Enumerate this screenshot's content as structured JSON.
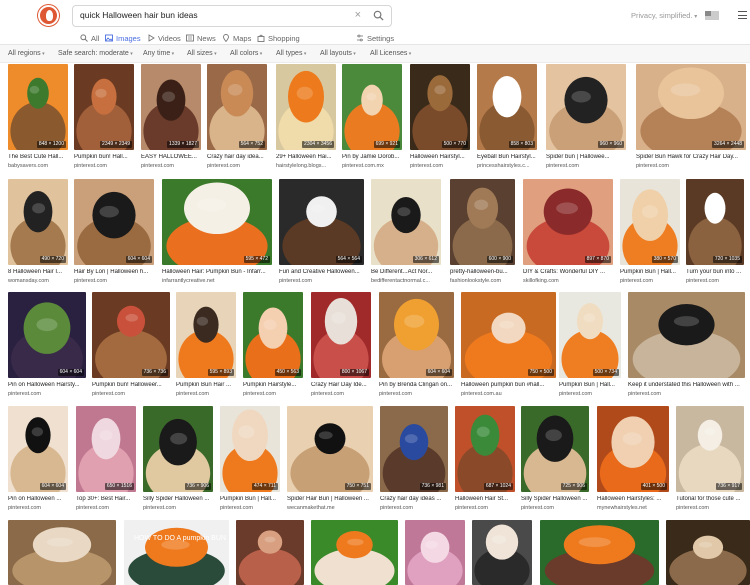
{
  "search": {
    "query": "quick Halloween hair bun ideas"
  },
  "header": {
    "privacy_label": "Privacy, simplified."
  },
  "tabs": [
    {
      "label": "All",
      "icon": "search-icon"
    },
    {
      "label": "Images",
      "icon": "image-icon",
      "active": true
    },
    {
      "label": "Videos",
      "icon": "play-icon"
    },
    {
      "label": "News",
      "icon": "newspaper-icon"
    },
    {
      "label": "Maps",
      "icon": "map-pin-icon"
    },
    {
      "label": "Shopping",
      "icon": "shopping-bag-icon"
    },
    {
      "label": "Settings",
      "icon": "settings-icon"
    }
  ],
  "filters": [
    "All regions",
    "Safe search: moderate",
    "Any time",
    "All sizes",
    "All colors",
    "All types",
    "All layouts",
    "All Licenses"
  ],
  "rows": [
    [
      {
        "caption": "The Best Cute Hall...",
        "source": "babysavers.com",
        "dims": "848 × 1200",
        "colors": [
          "#8a5a2e",
          "#3d7a2e",
          "#ee8b2a"
        ]
      },
      {
        "caption": "Pumpkin bun! Hall...",
        "source": "pinterest.com",
        "dims": "2349 × 2349",
        "colors": [
          "#a2603a",
          "#c76f3e",
          "#6b3a22"
        ]
      },
      {
        "caption": "EASY HALLOWEE...",
        "source": "pinterest.com",
        "dims": "1339 × 1827",
        "colors": [
          "#6a3b2a",
          "#3a2016",
          "#b68a6a"
        ]
      },
      {
        "caption": "Crazy hair day idea...",
        "source": "pinterest.com",
        "dims": "564 × 752",
        "colors": [
          "#d9b48a",
          "#c98a56",
          "#9a6a48"
        ]
      },
      {
        "caption": "29+ Halloween Hai...",
        "source": "hairstylelong.blogs...",
        "dims": "2304 × 3456",
        "colors": [
          "#f0dcaa",
          "#ed7a1c",
          "#d8c8a0"
        ]
      },
      {
        "caption": "Pin by Jamie Dorob...",
        "source": "pinterest.com.mx",
        "dims": "699 × 921",
        "colors": [
          "#ea7b20",
          "#f2d4b0",
          "#4a8a3a"
        ]
      },
      {
        "caption": "Halloween Hairstyl...",
        "source": "pinterest.com",
        "dims": "500 × 770",
        "colors": [
          "#7a4b2a",
          "#9a6a3a",
          "#3a2a1a"
        ]
      },
      {
        "caption": "Eyeball Bun Hairstyl...",
        "source": "princesshairstyles.c...",
        "dims": "858 × 803",
        "colors": [
          "#8a5a32",
          "#ffffff",
          "#b57a4a"
        ]
      },
      {
        "caption": "Spider bun | Hallowee...",
        "source": "pinterest.com",
        "dims": "960 × 960",
        "colors": [
          "#c9a078",
          "#222222",
          "#e4c4a0"
        ]
      },
      {
        "caption": "Spider Bun Hawk for Crazy Hair Day...",
        "source": "pinterest.com",
        "dims": "3264 × 2448",
        "colors": [
          "#b58258",
          "#e9c49a",
          "#d8b08a"
        ]
      }
    ],
    [
      {
        "caption": "8 Halloween Hair I...",
        "source": "womansday.com",
        "dims": "490 × 720",
        "colors": [
          "#a47a4e",
          "#222222",
          "#e0c29c"
        ]
      },
      {
        "caption": "Hair By Lori | Halloween h...",
        "source": "pinterest.com",
        "dims": "604 × 604",
        "colors": [
          "#9a6a40",
          "#1a1a1a",
          "#caa07a"
        ]
      },
      {
        "caption": "Halloween Hair: Pumpkin Bun - Infarr...",
        "source": "infarrantlycreative.net",
        "dims": "595 × 472",
        "colors": [
          "#ea6f1f",
          "#f5f0e6",
          "#3a7a2a"
        ]
      },
      {
        "caption": "Fun and Creative Halloween...",
        "source": "pinterest.com",
        "dims": "564 × 564",
        "colors": [
          "#5a3a24",
          "#f0f0f0",
          "#2a2a2a"
        ]
      },
      {
        "caption": "Be Different...Act Nor...",
        "source": "bedifferentactnormal.c...",
        "dims": "306 × 612",
        "colors": [
          "#d6b08a",
          "#1a1a1a",
          "#e8e0c8"
        ]
      },
      {
        "caption": "pretty-halloween-bu...",
        "source": "fashionlookstyle.com",
        "dims": "600 × 900",
        "colors": [
          "#8a6a4a",
          "#a07a56",
          "#5a4030"
        ]
      },
      {
        "caption": "DIY & Crafts: Wonderful DIY ...",
        "source": "skillofking.com",
        "dims": "897 × 870",
        "colors": [
          "#c94a3a",
          "#8a2a2a",
          "#e0a080"
        ]
      },
      {
        "caption": "Pumpkin Bun | Hall...",
        "source": "pinterest.com",
        "dims": "380 × 570",
        "colors": [
          "#ef7d22",
          "#f0d0a8",
          "#e8e4da"
        ]
      },
      {
        "caption": "Turn your bun into ...",
        "source": "pinterest.com",
        "dims": "720 × 1035",
        "colors": [
          "#8a6240",
          "#ffffff",
          "#5a3a24"
        ]
      }
    ],
    [
      {
        "caption": "Pin on Halloween Hairsty...",
        "source": "pinterest.com",
        "dims": "604 × 604",
        "colors": [
          "#3a2a4a",
          "#5a8a3a",
          "#2a2040"
        ]
      },
      {
        "caption": "Pumpkin bun! Halloweer...",
        "source": "pinterest.com",
        "dims": "736 × 736",
        "colors": [
          "#a26a3e",
          "#c9503a",
          "#6a3a22"
        ]
      },
      {
        "caption": "Pumpkin Bun Hair ...",
        "source": "pinterest.com",
        "dims": "595 × 893",
        "colors": [
          "#ef7a1e",
          "#3a2a20",
          "#e8d4b8"
        ]
      },
      {
        "caption": "Pumpkin Hairstyle...",
        "source": "pinterest.com",
        "dims": "450 × 563",
        "colors": [
          "#ea6f1a",
          "#f4cfb0",
          "#3a7a2a"
        ]
      },
      {
        "caption": "Crazy Hair Day Ide...",
        "source": "pinterest.com",
        "dims": "800 × 1067",
        "colors": [
          "#c9504a",
          "#e8e0d8",
          "#a02a2a"
        ]
      },
      {
        "caption": "Pin by Brenda Clingan on...",
        "source": "pinterest.com",
        "dims": "604 × 604",
        "colors": [
          "#d8a070",
          "#f0a030",
          "#9a6a40"
        ]
      },
      {
        "caption": "Halloween pumpkin bun #hall...",
        "source": "pinterest.com.au",
        "dims": "750 × 500",
        "colors": [
          "#ef7a1e",
          "#f2d8c0",
          "#c96a22"
        ]
      },
      {
        "caption": "Pumpkin Bun | Hall...",
        "source": "pinterest.com",
        "dims": "500 × 734",
        "colors": [
          "#ef7d22",
          "#f0dcc0",
          "#e8e8e0"
        ]
      },
      {
        "caption": "Keep it understated this Halloween with ...",
        "source": "pinterest.com",
        "dims": "",
        "colors": [
          "#c8b49a",
          "#1a1a1a",
          "#a88a66"
        ]
      }
    ],
    [
      {
        "caption": "Pin on Halloween ...",
        "source": "pinterest.com",
        "dims": "604 × 604",
        "colors": [
          "#d8b890",
          "#111111",
          "#f0e0d0"
        ]
      },
      {
        "caption": "Top 30+: Best Hair...",
        "source": "pinterest.com",
        "dims": "650 × 1516",
        "colors": [
          "#e0a0b0",
          "#f0d8e0",
          "#c07890"
        ]
      },
      {
        "caption": "Silly Spider Halloween ...",
        "source": "pinterest.com",
        "dims": "736 × 906",
        "colors": [
          "#e0c8a0",
          "#1a1a1a",
          "#3a6a2a"
        ]
      },
      {
        "caption": "Pumpkin Bun | Hall...",
        "source": "pinterest.com",
        "dims": "474 × 711",
        "colors": [
          "#ef7a1e",
          "#f0d8c0",
          "#e8e4da"
        ]
      },
      {
        "caption": "Spider Hair Bun | Halloween ...",
        "source": "wecanmakethat.me",
        "dims": "750 × 751",
        "colors": [
          "#c8a076",
          "#111111",
          "#e8d0b0"
        ]
      },
      {
        "caption": "Crazy hair day ideas ...",
        "source": "pinterest.com",
        "dims": "736 × 981",
        "colors": [
          "#5a3a2a",
          "#2a4aa0",
          "#8a6a4a"
        ]
      },
      {
        "caption": "Halloween Hair St...",
        "source": "pinterest.com",
        "dims": "687 × 1024",
        "colors": [
          "#8a4a2a",
          "#3a8a3a",
          "#c0502a"
        ]
      },
      {
        "caption": "Silly Spider Halloween ...",
        "source": "pinterest.com",
        "dims": "725 × 906",
        "colors": [
          "#d8b890",
          "#1a1a1a",
          "#3a6a2a"
        ]
      },
      {
        "caption": "Halloween Hairstyles: ...",
        "source": "mynewhairstyles.net",
        "dims": "401 × 500",
        "colors": [
          "#e86a1a",
          "#f0d0b0",
          "#b04a1a"
        ]
      },
      {
        "caption": "Tutorial for those cute ...",
        "source": "pinterest.com",
        "dims": "736 × 917",
        "colors": [
          "#e8d8c0",
          "#f4eee4",
          "#c8b8a0"
        ]
      }
    ],
    [
      {
        "caption": "",
        "source": "",
        "dims": "",
        "colors": [
          "#b8946a",
          "#e8d8c4",
          "#8a6a48"
        ]
      },
      {
        "caption": "",
        "source": "",
        "dims": "",
        "colors": [
          "#2a4a3a",
          "#ef7a1e",
          "#f0f0f0"
        ],
        "overlay": "HOW TO DO A pumpkin BUN"
      },
      {
        "caption": "",
        "source": "",
        "dims": "",
        "colors": [
          "#b8604a",
          "#d8a080",
          "#6a3a2a"
        ]
      },
      {
        "caption": "",
        "source": "",
        "dims": "",
        "colors": [
          "#f0e0d0",
          "#ef7a1e",
          "#3a8a2a"
        ]
      },
      {
        "caption": "",
        "source": "",
        "dims": "",
        "colors": [
          "#e0a0c0",
          "#f4d8e4",
          "#c07898"
        ]
      },
      {
        "caption": "",
        "source": "",
        "dims": "",
        "colors": [
          "#2a2a2a",
          "#f0e4d8",
          "#4a4a4a"
        ]
      },
      {
        "caption": "",
        "source": "",
        "dims": "",
        "colors": [
          "#6a3a2a",
          "#ef7a1e",
          "#2a6a2a"
        ]
      },
      {
        "caption": "",
        "source": "",
        "dims": "",
        "colors": [
          "#8a6a4a",
          "#e0c8a8",
          "#3a2a1a"
        ]
      }
    ]
  ]
}
